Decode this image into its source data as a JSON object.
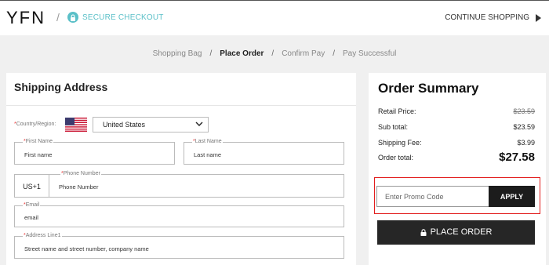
{
  "header": {
    "logo": "YFN",
    "slash": "/",
    "secure_checkout": "SECURE CHECKOUT",
    "continue_shopping": "CONTINUE SHOPPING"
  },
  "steps": {
    "items": [
      "Shopping Bag",
      "Place Order",
      "Confirm Pay",
      "Pay Successful"
    ],
    "separator": "/",
    "active_index": 1
  },
  "shipping": {
    "title": "Shipping Address",
    "country_label": "Country/Region:",
    "country_value": "United States",
    "first_name_label": "First Name",
    "first_name_placeholder": "First name",
    "last_name_label": "Last Name",
    "last_name_placeholder": "Last name",
    "phone_prefix": "US+1",
    "phone_label": "Phone Number",
    "phone_placeholder": "Phone Number",
    "email_label": "Email",
    "email_placeholder": "email",
    "address_label": "Address Line1",
    "address_placeholder": "Street name and street number, company name",
    "required_mark": "*"
  },
  "summary": {
    "title": "Order Summary",
    "retail_label": "Retail Price:",
    "retail_value": "$23.59",
    "subtotal_label": "Sub total:",
    "subtotal_value": "$23.59",
    "shipping_label": "Shipping Fee:",
    "shipping_value": "$3.99",
    "total_label": "Order total:",
    "total_value": "$27.58",
    "promo_placeholder": "Enter Promo Code",
    "apply_label": "APPLY",
    "place_order_label": "PLACE ORDER"
  },
  "colors": {
    "accent": "#5bc0c8",
    "highlight_border": "#e21d1d",
    "button_dark": "#262626"
  }
}
